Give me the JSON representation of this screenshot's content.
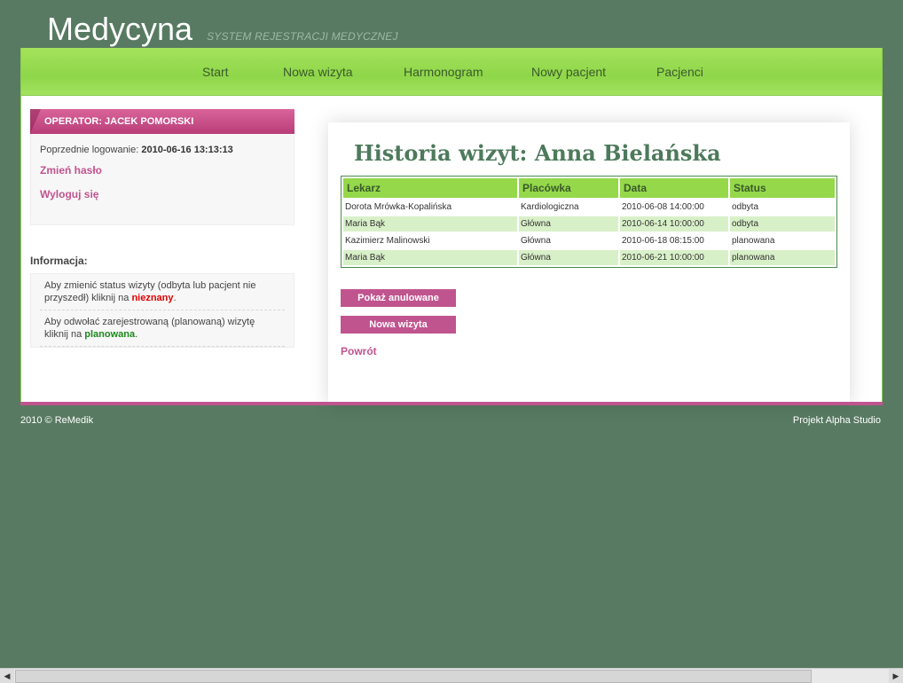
{
  "brand": {
    "title": "Medycyna",
    "subtitle": "SYSTEM REJESTRACJI MEDYCZNEJ"
  },
  "nav": {
    "items": [
      "Start",
      "Nowa wizyta",
      "Harmonogram",
      "Nowy pacjent",
      "Pacjenci"
    ]
  },
  "sidebar": {
    "operator": "OPERATOR: JACEK POMORSKI",
    "last_login_label": "Poprzednie logowanie:",
    "last_login_value": "2010-06-16 13:13:13",
    "change_password": "Zmień hasło",
    "logout": "Wyloguj się",
    "info_title": "Informacja:",
    "info1_pre": "Aby zmienić status wizyty (odbyta lub pacjent nie przyszedł) kliknij na",
    "info1_key": "nieznany",
    "info2_pre": "Aby odwołać zarejestrowaną (planowaną) wizytę kliknij na",
    "info2_key": "planowana",
    "dot": "."
  },
  "main": {
    "title": "Historia wizyt: Anna Bielańska",
    "columns": [
      "Lekarz",
      "Placówka",
      "Data",
      "Status"
    ],
    "rows": [
      {
        "doctor": "Dorota Mrówka-Kopalińska",
        "clinic": "Kardiologiczna",
        "date": "2010-06-08 14:00:00",
        "status": "odbyta"
      },
      {
        "doctor": "Maria Bąk",
        "clinic": "Główna",
        "date": "2010-06-14 10:00:00",
        "status": "odbyta"
      },
      {
        "doctor": "Kazimierz Malinowski",
        "clinic": "Główna",
        "date": "2010-06-18 08:15:00",
        "status": "planowana"
      },
      {
        "doctor": "Maria Bąk",
        "clinic": "Główna",
        "date": "2010-06-21 10:00:00",
        "status": "planowana"
      }
    ],
    "show_cancelled": "Pokaż anulowane",
    "new_visit": "Nowa wizyta",
    "back": "Powrót"
  },
  "footer": {
    "left": "2010 © ReMedik",
    "right": "Projekt Alpha Studio"
  },
  "colors": {
    "background": "#587a62",
    "accent_green": "#95d84a",
    "accent_pink": "#c0548f"
  }
}
